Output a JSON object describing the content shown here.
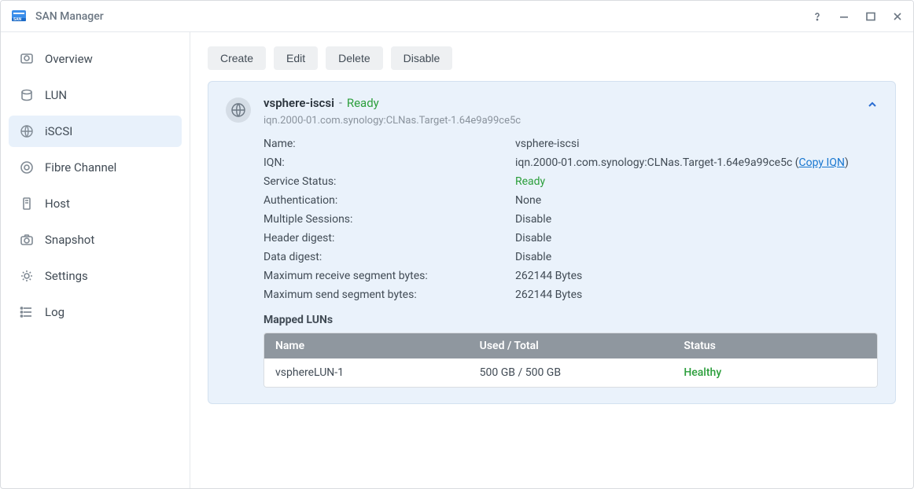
{
  "window": {
    "title": "SAN Manager"
  },
  "sidebar": {
    "items": [
      {
        "id": "overview",
        "label": "Overview"
      },
      {
        "id": "lun",
        "label": "LUN"
      },
      {
        "id": "iscsi",
        "label": "iSCSI",
        "active": true
      },
      {
        "id": "fibre",
        "label": "Fibre Channel"
      },
      {
        "id": "host",
        "label": "Host"
      },
      {
        "id": "snapshot",
        "label": "Snapshot"
      },
      {
        "id": "settings",
        "label": "Settings"
      },
      {
        "id": "log",
        "label": "Log"
      }
    ]
  },
  "toolbar": {
    "create": "Create",
    "edit": "Edit",
    "delete": "Delete",
    "disable": "Disable"
  },
  "target": {
    "name_title": "vsphere-iscsi",
    "status_label": "Ready",
    "subtitle": "iqn.2000-01.com.synology:CLNas.Target-1.64e9a99ce5c",
    "fields": {
      "name_k": "Name:",
      "name_v": "vsphere-iscsi",
      "iqn_k": "IQN:",
      "iqn_v": "iqn.2000-01.com.synology:CLNas.Target-1.64e9a99ce5c",
      "iqn_copy": "Copy IQN",
      "svc_k": "Service Status:",
      "svc_v": "Ready",
      "auth_k": "Authentication:",
      "auth_v": "None",
      "sess_k": "Multiple Sessions:",
      "sess_v": "Disable",
      "hdr_k": "Header digest:",
      "hdr_v": "Disable",
      "data_k": "Data digest:",
      "data_v": "Disable",
      "mrs_k": "Maximum receive segment bytes:",
      "mrs_v": "262144 Bytes",
      "mss_k": "Maximum send segment bytes:",
      "mss_v": "262144 Bytes"
    },
    "mapped": {
      "heading": "Mapped LUNs",
      "cols": {
        "name": "Name",
        "used": "Used / Total",
        "status": "Status"
      },
      "rows": [
        {
          "name": "vsphereLUN-1",
          "used": "500 GB / 500 GB",
          "status": "Healthy"
        }
      ]
    }
  }
}
